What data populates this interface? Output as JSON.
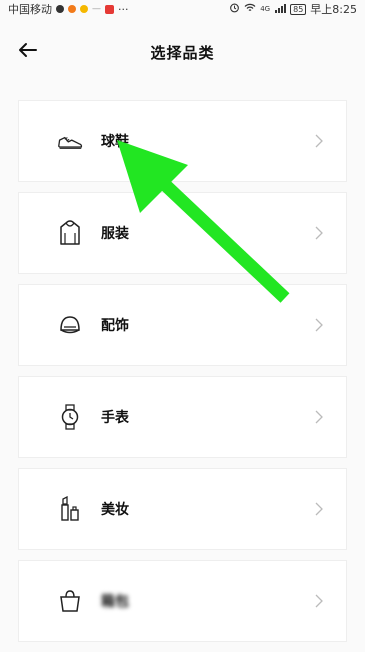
{
  "status_bar": {
    "carrier": "中国移动",
    "ellipsis": "···",
    "network": "4G",
    "battery": "85",
    "time": "早上8:25",
    "icons": [
      "chat-icon",
      "app-icon",
      "app-icon",
      "news-app-icon",
      "alarm-icon",
      "wifi-icon",
      "signal-icon",
      "battery-icon"
    ]
  },
  "header": {
    "title": "选择品类",
    "back_icon": "back-arrow-icon"
  },
  "categories": [
    {
      "label": "球鞋",
      "icon": "sneaker-icon"
    },
    {
      "label": "服装",
      "icon": "hoodie-icon"
    },
    {
      "label": "配饰",
      "icon": "cap-icon"
    },
    {
      "label": "手表",
      "icon": "watch-icon"
    },
    {
      "label": "美妆",
      "icon": "lipstick-icon"
    },
    {
      "label": "箱包",
      "icon": "bag-icon"
    }
  ],
  "annotation": {
    "color": "#22e622",
    "shape": "pointing-arrow"
  }
}
